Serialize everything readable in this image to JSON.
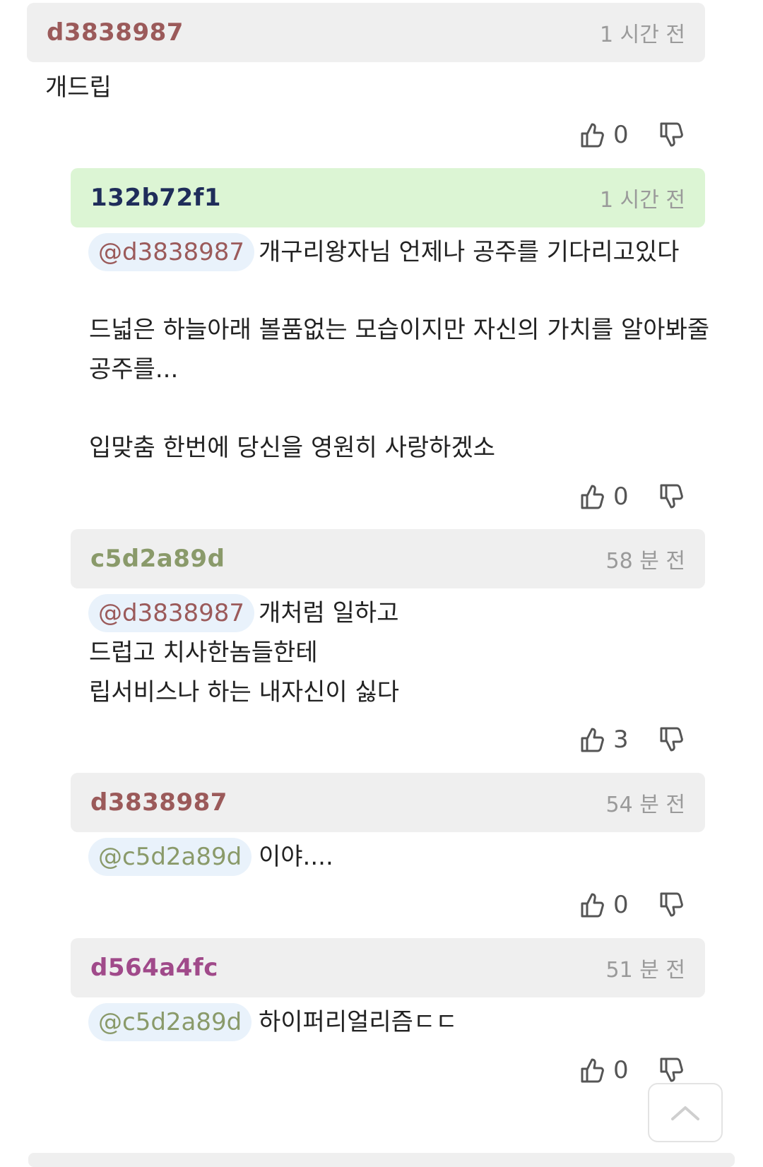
{
  "comments": [
    {
      "author": "d3838987",
      "author_color": "#9b5a5a",
      "time": "1 시간 전",
      "header_bg": "gray",
      "lines": [
        "개드립"
      ],
      "likes": "0"
    },
    {
      "author": "132b72f1",
      "author_color": "#1f2d5a",
      "time": "1 시간 전",
      "header_bg": "green",
      "mention": "@d3838987",
      "lines": [
        "개구리왕자님 언제나 공주를 기다리고있다",
        "드넓은 하늘아래 볼품없는 모습이지만 자신의 가치를 알아봐줄",
        "공주를...",
        "입맞춤 한번에 당신을 영원히 사랑하겠소"
      ],
      "likes": "0"
    },
    {
      "author": "c5d2a89d",
      "author_color": "#8a9a6a",
      "time": "58 분 전",
      "header_bg": "gray",
      "mention": "@d3838987",
      "lines": [
        "개처럼 일하고",
        "드럽고 치사한놈들한테",
        "립서비스나 하는 내자신이 싫다"
      ],
      "likes": "3"
    },
    {
      "author": "d3838987",
      "author_color": "#9b5a5a",
      "time": "54 분 전",
      "header_bg": "gray",
      "mention": "@c5d2a89d",
      "lines": [
        "이야...."
      ],
      "likes": "0"
    },
    {
      "author": "d564a4fc",
      "author_color": "#a04a8a",
      "time": "51 분 전",
      "header_bg": "gray",
      "mention": "@c5d2a89d",
      "lines": [
        "하이퍼리얼리즘ㄷㄷ"
      ],
      "likes": "0"
    }
  ],
  "mention_colors": {
    "@d3838987": "#9b5a5a",
    "@c5d2a89d": "#8a9a6a"
  },
  "icons": {
    "like": "thumbs-up-icon",
    "dislike": "thumbs-down-icon",
    "scroll_top": "chevron-up-icon"
  }
}
